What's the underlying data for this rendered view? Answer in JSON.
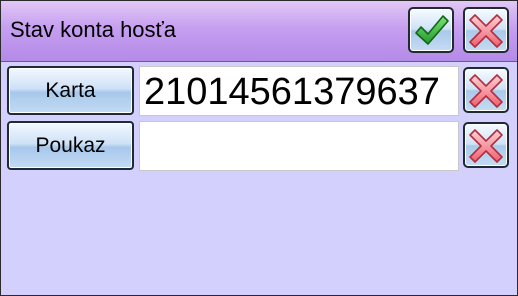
{
  "dialog": {
    "title": "Stav konta hosťa"
  },
  "header_buttons": {
    "confirm_icon": "check-icon",
    "cancel_icon": "close-icon"
  },
  "rows": [
    {
      "label": "Karta",
      "value": "21014561379637",
      "clear_icon": "close-icon"
    },
    {
      "label": "Poukaz",
      "value": "",
      "clear_icon": "close-icon"
    }
  ],
  "colors": {
    "background": "#d4d0fd",
    "titlebar": "#c59ff0",
    "button": "#cfe1f6",
    "check": "#2db52d",
    "cross": "#f05a6b"
  }
}
